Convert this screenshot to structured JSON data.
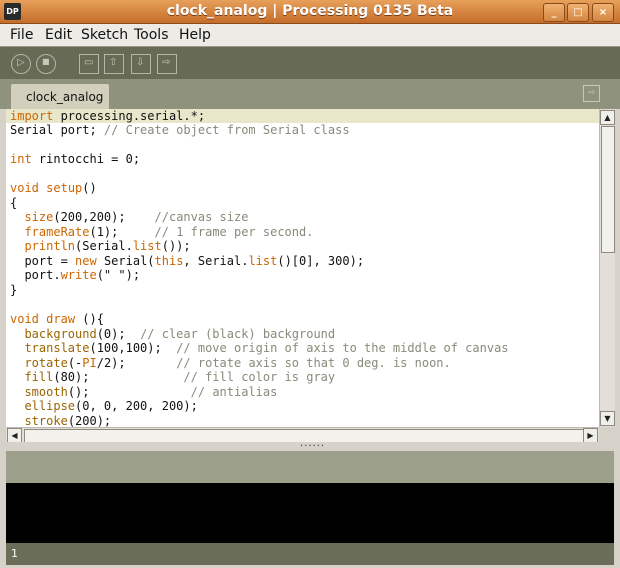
{
  "window": {
    "title": "clock_analog | Processing 0135 Beta",
    "app_icon_label": "DP",
    "controls": {
      "minimize": "_",
      "maximize": "□",
      "close": "×"
    }
  },
  "menu": {
    "file": "File",
    "edit": "Edit",
    "sketch": "Sketch",
    "tools": "Tools",
    "help": "Help"
  },
  "toolbar": {
    "buttons": [
      "run",
      "stop",
      "new",
      "open",
      "save",
      "export"
    ],
    "icons": {
      "run": "▷",
      "stop": "■",
      "new": "▭",
      "open": "⇧",
      "save": "⇩",
      "export": "⇨"
    }
  },
  "tabs": {
    "active": "clock_analog",
    "menu_icon": "⇨"
  },
  "editor": {
    "line1_a": "i",
    "line1_b": "mport",
    "line1_c": " processing.serial.*;",
    "line2_a": "Serial port; ",
    "line2_b": "// Create object from Serial class",
    "line4_a": "int",
    "line4_b": " rintocchi = 0;",
    "line6_a": "void",
    "line6_b": " ",
    "line6_c": "setup",
    "line6_d": "()",
    "line7": "{",
    "line8_a": "  ",
    "line8_b": "size",
    "line8_c": "(200,200);    ",
    "line8_d": "//canvas size",
    "line9_a": "  ",
    "line9_b": "frameRate",
    "line9_c": "(1);     ",
    "line9_d": "// 1 frame per second.",
    "line10_a": "  ",
    "line10_b": "println",
    "line10_c": "(Serial.",
    "line10_d": "list",
    "line10_e": "());",
    "line11_a": "  port = ",
    "line11_b": "new",
    "line11_c": " Serial(",
    "line11_d": "this",
    "line11_e": ", Serial.",
    "line11_f": "list",
    "line11_g": "()[0], 300);",
    "line12_a": "  port.",
    "line12_b": "write",
    "line12_c": "(\" \");",
    "line13": "}",
    "line15_a": "void",
    "line15_b": " ",
    "line15_c": "draw",
    "line15_d": " (){",
    "line16_a": "  ",
    "line16_b": "background",
    "line16_c": "(0);  ",
    "line16_d": "// clear (black) background",
    "line17_a": "  ",
    "line17_b": "translate",
    "line17_c": "(100,100);  ",
    "line17_d": "// move origin of axis to the middle of canvas",
    "line18_a": "  ",
    "line18_b": "rotate",
    "line18_c": "(-",
    "line18_d": "PI",
    "line18_e": "/2);       ",
    "line18_f": "// rotate axis so that 0 deg. is noon.",
    "line19_a": "  ",
    "line19_b": "fill",
    "line19_c": "(80);             ",
    "line19_d": "// fill color is gray",
    "line20_a": "  ",
    "line20_b": "smooth",
    "line20_c": "();              ",
    "line20_d": "// antialias",
    "line21_a": "  ",
    "line21_b": "ellipse",
    "line21_c": "(0, 0, 200, 200);",
    "line22_a": "  ",
    "line22_b": "stroke",
    "line22_c": "(200);"
  },
  "scroll": {
    "up": "▲",
    "down": "▼",
    "left": "◀",
    "right": "▶"
  },
  "divider": {
    "grip": "......"
  },
  "status": {
    "line_number": "1"
  }
}
